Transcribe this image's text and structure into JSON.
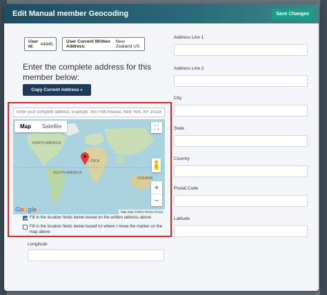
{
  "modal": {
    "title": "Edit Manual member Geocoding",
    "save_label": "Save Changes"
  },
  "info": {
    "user_id_label": "User Id:",
    "user_id_value": "44845",
    "address_label": "User Current Written Address:",
    "address_value": "New Zealand US"
  },
  "left": {
    "heading": "Enter the complete address for this member below:",
    "copy_button": "Copy Current Address »",
    "search_placeholder": "Enter your complete address. Example: 350 Fifth Avenue, New York, NY 10118",
    "map_tab_map": "Map",
    "map_tab_satellite": "Satellite",
    "map_footer": "Map data ©2021   Terms of Use",
    "google_logo": [
      "G",
      "o",
      "o",
      "g",
      "l",
      "e"
    ],
    "map_labels": {
      "north_america": "NORTH AMERICA",
      "south_america": "SOUTH AMERICA",
      "africa": "RICA",
      "oceania": "OCEANIA"
    },
    "checkbox_written": {
      "checked": true,
      "label": "Fill in the location fields below based on the written address above"
    },
    "checkbox_marker": {
      "checked": false,
      "label": "Fill in the location fields below based on where I move the marker on the map above"
    },
    "longitude_label": "Longitude"
  },
  "right": {
    "fields": [
      "Address Line 1",
      "Address Line 2",
      "City",
      "State",
      "Country",
      "Postal Code",
      "Latitude"
    ]
  },
  "colors": {
    "header_start": "#1f4d63",
    "save_button": "#16a085",
    "copy_button": "#1f3a56",
    "map_border": "#e02424",
    "marker": "#e53935"
  },
  "icons": [
    "fullscreen-icon",
    "pegman-icon",
    "zoom-in-icon",
    "zoom-out-icon",
    "map-marker-icon"
  ]
}
